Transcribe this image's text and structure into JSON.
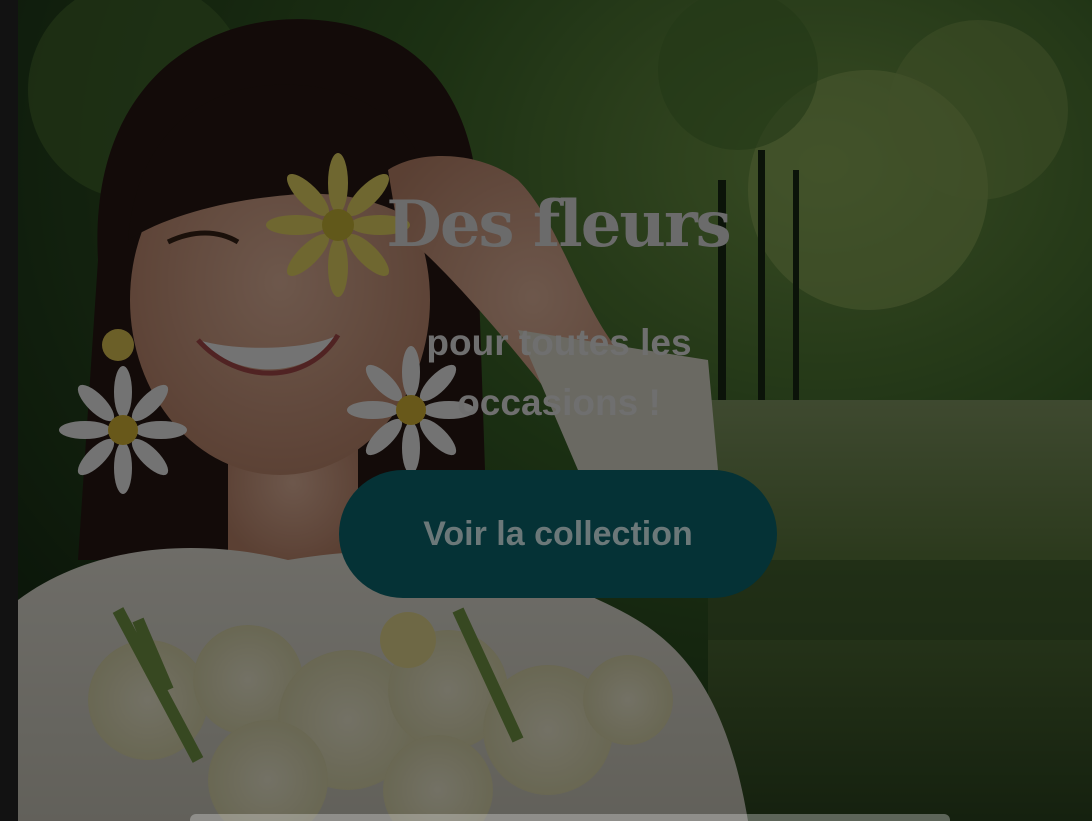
{
  "hero": {
    "title": "Des fleurs",
    "subtitle_line1": "pour toutes les",
    "subtitle_line2": "occasions !",
    "cta_label": "Voir la collection"
  },
  "colors": {
    "cta_background": "#053236",
    "overlay": "rgba(0,0,0,0.55)",
    "title_text": "#6b6b6b"
  },
  "image": {
    "subject": "smiling woman holding a yellow daisy over one eye, daisy earrings, bouquet of white flowers, park background"
  }
}
